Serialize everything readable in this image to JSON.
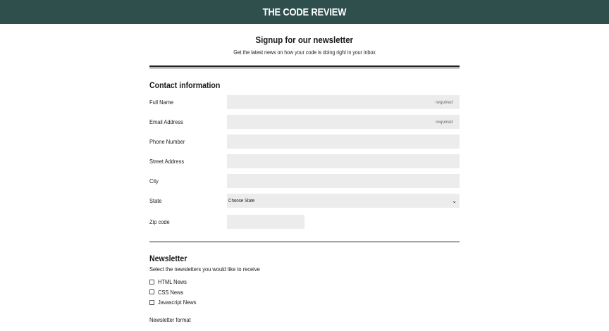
{
  "header": {
    "brand": "THE CODE REVIEW"
  },
  "intro": {
    "title": "Signup for our newsletter",
    "subtitle": "Get the latest news on how your code is doing right in your inbox"
  },
  "contact": {
    "title": "Contact information",
    "fields": {
      "full_name": {
        "label": "Full Name",
        "hint": "required"
      },
      "email": {
        "label": "Email Address",
        "hint": "required"
      },
      "phone": {
        "label": "Phone Number"
      },
      "street": {
        "label": "Street Address"
      },
      "city": {
        "label": "City"
      },
      "state": {
        "label": "State",
        "selected": "Choose State"
      },
      "zip": {
        "label": "Zip code"
      }
    }
  },
  "newsletter": {
    "title": "Newsletter",
    "subtitle": "Select the newsletters you would like to receive",
    "options": [
      "HTML News",
      "CSS News",
      "Javascript News"
    ],
    "format_label": "Newsletter format"
  }
}
